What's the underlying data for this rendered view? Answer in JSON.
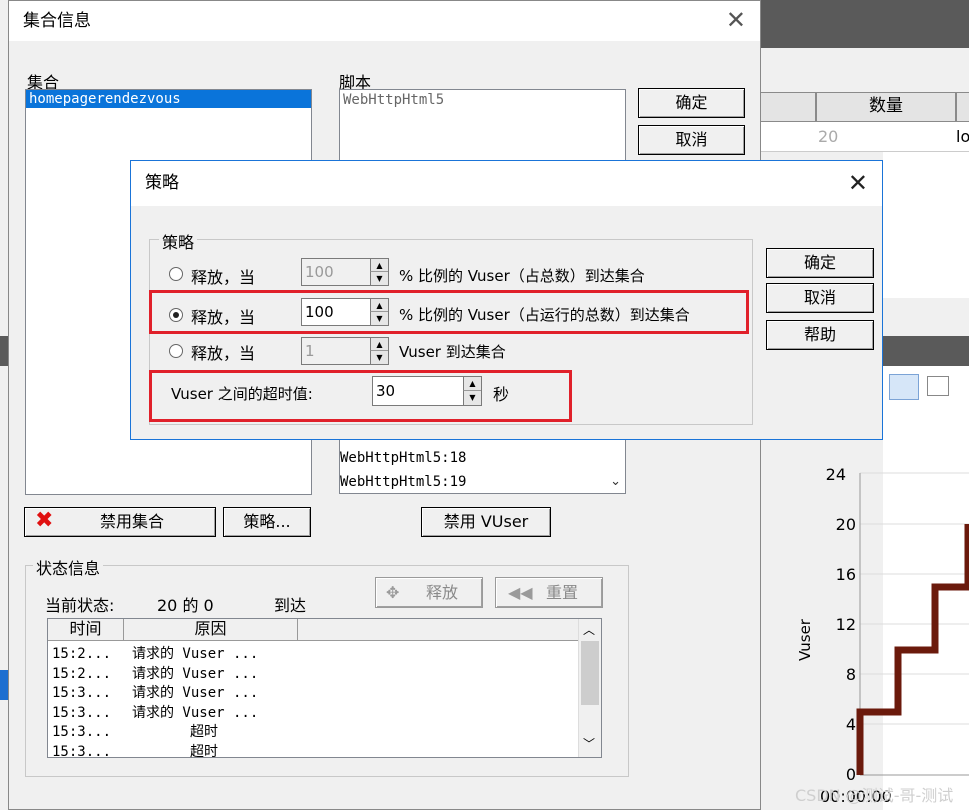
{
  "background": {
    "grid_header_count": "数量",
    "grid_value_count": "20",
    "grid_value_right": "lo",
    "chart": {
      "ylabel": "Vuser",
      "yticks": [
        "24",
        "20",
        "16",
        "12",
        "8",
        "4",
        "0"
      ],
      "xtick": "00:00:00",
      "line_color": "#6b1a0c"
    }
  },
  "main_dialog": {
    "title": "集合信息",
    "rendezvous_label": "集合",
    "rendezvous_items": [
      "homepagerendezvous"
    ],
    "script_label": "脚本",
    "script_items": [
      "WebHttpHtml5"
    ],
    "ok_label": "确定",
    "cancel_label": "取消",
    "script_list_lower": [
      "WebHttpHtml5:18",
      "WebHttpHtml5:19"
    ],
    "disable_rendezvous_label": "禁用集合",
    "policy_button_label": "策略...",
    "disable_vuser_label": "禁用 VUser",
    "status_group_label": "状态信息",
    "current_status_label": "当前状态:",
    "current_status_value": "20 的 0",
    "arrived_label": "到达",
    "release_label": "释放",
    "reset_label": "重置",
    "table_headers": [
      "时间",
      "原因"
    ],
    "table_rows": [
      {
        "time": "15:2...",
        "reason": "请求的 Vuser ..."
      },
      {
        "time": "15:2...",
        "reason": "请求的 Vuser ..."
      },
      {
        "time": "15:3...",
        "reason": "请求的 Vuser ..."
      },
      {
        "time": "15:3...",
        "reason": "请求的 Vuser ..."
      },
      {
        "time": "15:3...",
        "reason": "超时"
      },
      {
        "time": "15:3...",
        "reason": "超时"
      }
    ]
  },
  "policy_dialog": {
    "title": "策略",
    "group_label": "策略",
    "option1_prefix": "释放，当",
    "option1_value": "100",
    "option1_suffix": "% 比例的 Vuser（占总数）到达集合",
    "option2_prefix": "释放，当",
    "option2_value": "100",
    "option2_suffix": "% 比例的 Vuser（占运行的总数）到达集合",
    "option3_prefix": "释放，当",
    "option3_value": "1",
    "option3_suffix": "Vuser 到达集合",
    "timeout_label": "Vuser 之间的超时值:",
    "timeout_value": "30",
    "timeout_unit": "秒",
    "ok_label": "确定",
    "cancel_label": "取消",
    "help_label": "帮助",
    "selected_option": 2,
    "highlight_color": "#e0202a"
  },
  "watermark": "CSDN @测试-哥-测试"
}
